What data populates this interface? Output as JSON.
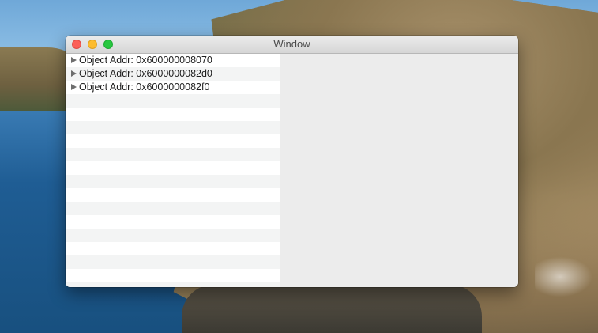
{
  "window": {
    "title": "Window"
  },
  "outline": {
    "items": [
      {
        "label": "Object Addr: 0x600000008070"
      },
      {
        "label": "Object Addr: 0x6000000082d0"
      },
      {
        "label": "Object Addr: 0x6000000082f0"
      }
    ]
  }
}
